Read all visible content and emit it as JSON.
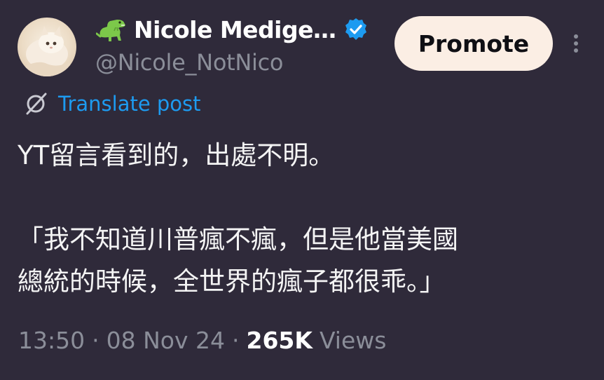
{
  "author": {
    "display_name": "Nicole Medige…",
    "handle": "@Nicole_NotNico",
    "name_emoji": "dinosaur-icon",
    "verified": "verified-badge-icon"
  },
  "actions": {
    "promote_label": "Promote",
    "more": "more-vertical-icon"
  },
  "translate": {
    "label": "Translate post",
    "icon": "translate-icon"
  },
  "post": {
    "lines": [
      "YT留言看到的，出處不明。",
      "",
      "「我不知道川普瘋不瘋，但是他當美國",
      "總統的時候，全世界的瘋子都很乖。」"
    ]
  },
  "meta": {
    "time": "13:50",
    "date": "08 Nov 24",
    "separator": "·",
    "views_count": "265K",
    "views_label": "Views"
  },
  "colors": {
    "background": "#2f2a3a",
    "link": "#1d9bf0",
    "verified": "#1d9bf0",
    "promote_bg": "#fbeee4",
    "muted": "#8b8e99"
  }
}
